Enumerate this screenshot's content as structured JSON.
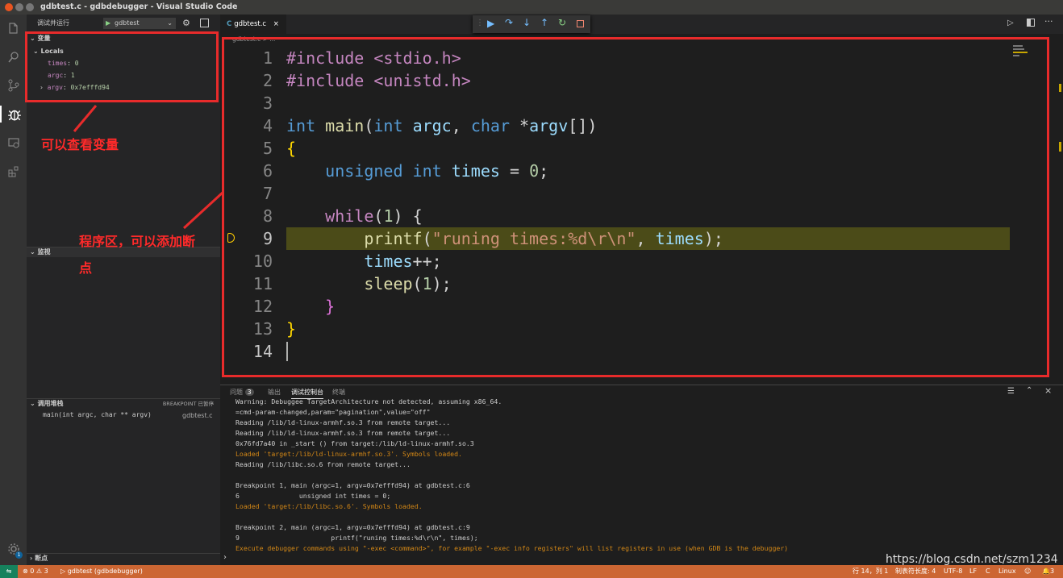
{
  "window_title": "gdbtest.c - gdbdebugger - Visual Studio Code",
  "sidebar": {
    "run_label": "调试并运行",
    "config": "gdbtest",
    "variables_header": "变量",
    "locals_header": "Locals",
    "variables": [
      {
        "name": "times",
        "value": "0"
      },
      {
        "name": "argc",
        "value": "1"
      },
      {
        "name": "argv",
        "value": "0x7efffd94"
      }
    ],
    "watch_header": "监视",
    "callstack_header": "调用堆栈",
    "callstack_badge": "BREAKPOINT 已暂停",
    "callstack_frame": "main(int argc, char ** argv)",
    "callstack_file": "gdbtest.c",
    "breakpoints_header": "断点"
  },
  "editor": {
    "tab": "gdbtest.c",
    "breadcrumb": "gdbtest.c > ...",
    "line_numbers": [
      "1",
      "2",
      "3",
      "4",
      "5",
      "6",
      "7",
      "8",
      "9",
      "10",
      "11",
      "12",
      "13",
      "14"
    ],
    "current_line": "9"
  },
  "code": {
    "l1": "#include <stdio.h>",
    "l2": "#include <unistd.h>",
    "l4_kw": "int",
    "l4_fn": "main",
    "l4_p1": "(",
    "l4_t1": "int",
    "l4_a1": "argc",
    "l4_c": ", ",
    "l4_t2": "char",
    "l4_s": " *",
    "l4_a2": "argv",
    "l4_e": "[])",
    "l5": "{",
    "l6_kw": "unsigned int",
    "l6_id": "times",
    "l6_eq": " = ",
    "l6_num": "0",
    "l6_end": ";",
    "l8_kw": "while",
    "l8_p": "(",
    "l8_num": "1",
    "l8_end": ") {",
    "l9_fn": "printf",
    "l9_p": "(",
    "l9_str": "\"runing times:%d\\r\\n\"",
    "l9_c": ", ",
    "l9_id": "times",
    "l9_end": ");",
    "l10_id": "times",
    "l10_end": "++;",
    "l11_fn": "sleep",
    "l11_p": "(",
    "l11_num": "1",
    "l11_end": ");",
    "l12": "}",
    "l13": "}"
  },
  "panel": {
    "tabs": [
      "问题",
      "输出",
      "调试控制台",
      "终端"
    ],
    "problems_count": "3",
    "output_lines": [
      {
        "text": "Warning: Debuggee TargetArchitecture not detected, assuming x86_64.",
        "color": "#cccccc"
      },
      {
        "text": "=cmd-param-changed,param=\"pagination\",value=\"off\"",
        "color": "#cccccc"
      },
      {
        "text": "Reading /lib/ld-linux-armhf.so.3 from remote target...",
        "color": "#cccccc"
      },
      {
        "text": "Reading /lib/ld-linux-armhf.so.3 from remote target...",
        "color": "#cccccc"
      },
      {
        "text": "0x76fd7a40 in _start () from target:/lib/ld-linux-armhf.so.3",
        "color": "#cccccc"
      },
      {
        "text": "Loaded 'target:/lib/ld-linux-armhf.so.3'. Symbols loaded.",
        "color": "#d18616"
      },
      {
        "text": "Reading /lib/libc.so.6 from remote target...",
        "color": "#cccccc"
      },
      {
        "text": "",
        "color": "#cccccc"
      },
      {
        "text": "Breakpoint 1, main (argc=1, argv=0x7efffd94) at gdbtest.c:6",
        "color": "#cccccc"
      },
      {
        "text": "6               unsigned int times = 0;",
        "color": "#cccccc"
      },
      {
        "text": "Loaded 'target:/lib/libc.so.6'. Symbols loaded.",
        "color": "#d18616"
      },
      {
        "text": "",
        "color": "#cccccc"
      },
      {
        "text": "Breakpoint 2, main (argc=1, argv=0x7efffd94) at gdbtest.c:9",
        "color": "#cccccc"
      },
      {
        "text": "9                       printf(\"runing times:%d\\r\\n\", times);",
        "color": "#cccccc"
      },
      {
        "text": "Execute debugger commands using \"-exec <command>\", for example \"-exec info registers\" will list registers in use (when GDB is the debugger)",
        "color": "#d18616"
      }
    ],
    "prompt": "›"
  },
  "status": {
    "errors": "0",
    "warnings": "3",
    "debug_target": "gdbtest (gdbdebugger)",
    "position": "行 14，列 1",
    "tab_size": "制表符长度: 4",
    "encoding": "UTF-8",
    "eol": "LF",
    "language": "C",
    "platform": "Linux",
    "notifications": "3"
  },
  "annotations": {
    "vars_note": "可以查看变量",
    "code_note_1": "程序区，可以添加断",
    "code_note_2": "点"
  },
  "watermark": "https://blog.csdn.net/szm1234"
}
